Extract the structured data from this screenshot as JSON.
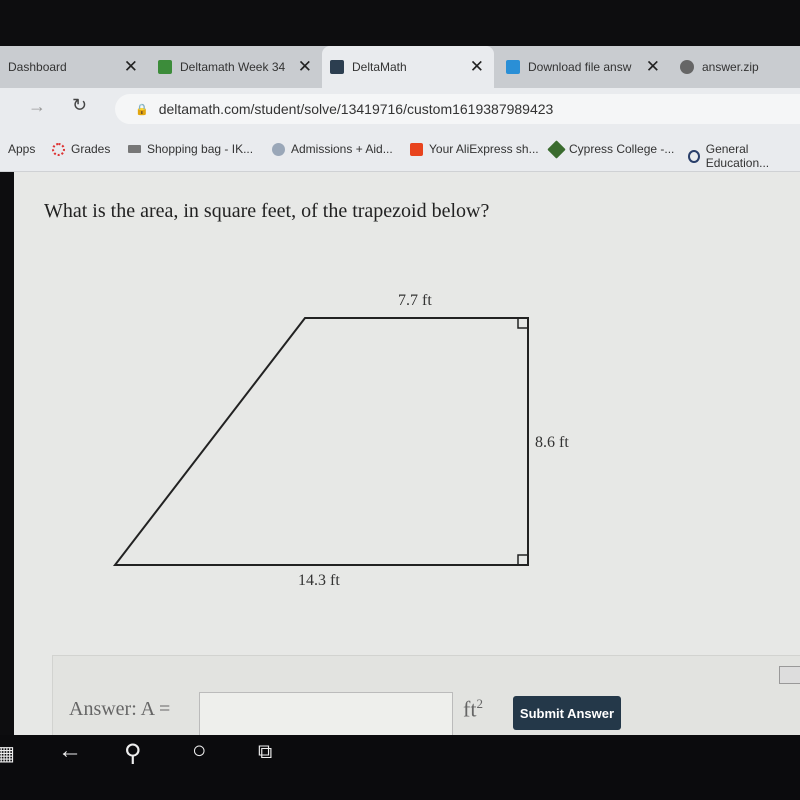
{
  "tabs": [
    {
      "label": "Dashboard",
      "active": false
    },
    {
      "label": "Deltamath Week 34",
      "active": false
    },
    {
      "label": "DeltaMath",
      "active": true
    },
    {
      "label": "Download file answ",
      "active": false
    },
    {
      "label": "answer.zip",
      "active": false
    }
  ],
  "address_bar": {
    "url": "deltamath.com/student/solve/13419716/custom1619387989423"
  },
  "bookmarks": [
    "Apps",
    "Grades",
    "Shopping bag - IK...",
    "Admissions + Aid...",
    "Your AliExpress sh...",
    "Cypress College -...",
    "General Education..."
  ],
  "problem": {
    "question": "What is the area, in square feet, of the trapezoid below?",
    "top_label": "7.7 ft",
    "right_label": "8.6 ft",
    "bottom_label": "14.3 ft"
  },
  "answer": {
    "label": "Answer:  A =",
    "value": "",
    "unit": "ft",
    "unit_exp": "2",
    "submit": "Submit Answer"
  },
  "taskbar": {
    "icons": [
      "windows-icon",
      "back-icon",
      "search-icon",
      "cortana-icon",
      "task-view-icon"
    ]
  }
}
